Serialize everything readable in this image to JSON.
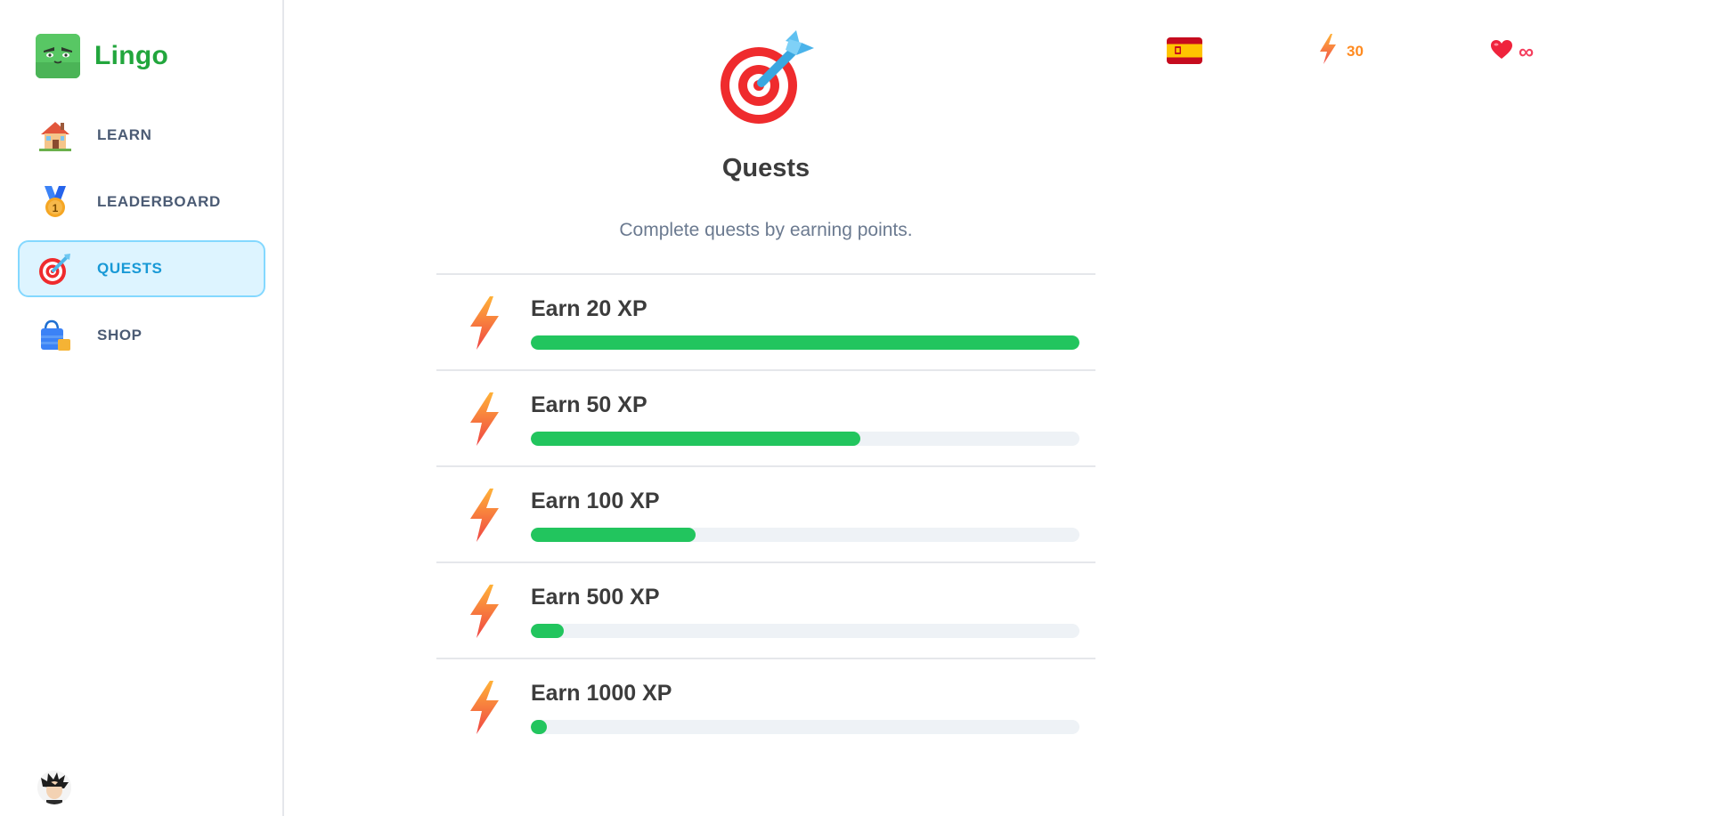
{
  "app": {
    "name": "Lingo"
  },
  "sidebar": {
    "items": [
      {
        "label": "LEARN",
        "icon": "house-icon",
        "active": false
      },
      {
        "label": "LEADERBOARD",
        "icon": "medal-icon",
        "active": false
      },
      {
        "label": "QUESTS",
        "icon": "target-icon",
        "active": true
      },
      {
        "label": "SHOP",
        "icon": "shopping-bag-icon",
        "active": false
      }
    ]
  },
  "header": {
    "language_flag": "spain-flag-icon",
    "xp": "30",
    "hearts": "∞"
  },
  "page": {
    "title": "Quests",
    "subtitle": "Complete quests by earning points."
  },
  "quests": [
    {
      "title": "Earn 20 XP",
      "progress": 1.0
    },
    {
      "title": "Earn 50 XP",
      "progress": 0.6
    },
    {
      "title": "Earn 100 XP",
      "progress": 0.3
    },
    {
      "title": "Earn 500 XP",
      "progress": 0.06
    },
    {
      "title": "Earn 1000 XP",
      "progress": 0.03
    }
  ],
  "colors": {
    "brand": "#22a63d",
    "active_bg": "#ddf4ff",
    "active_border": "#84d8ff",
    "active_text": "#1899d6",
    "progress": "#22c55e",
    "xp": "#ff8a1f",
    "hearts": "#f43f5e"
  }
}
